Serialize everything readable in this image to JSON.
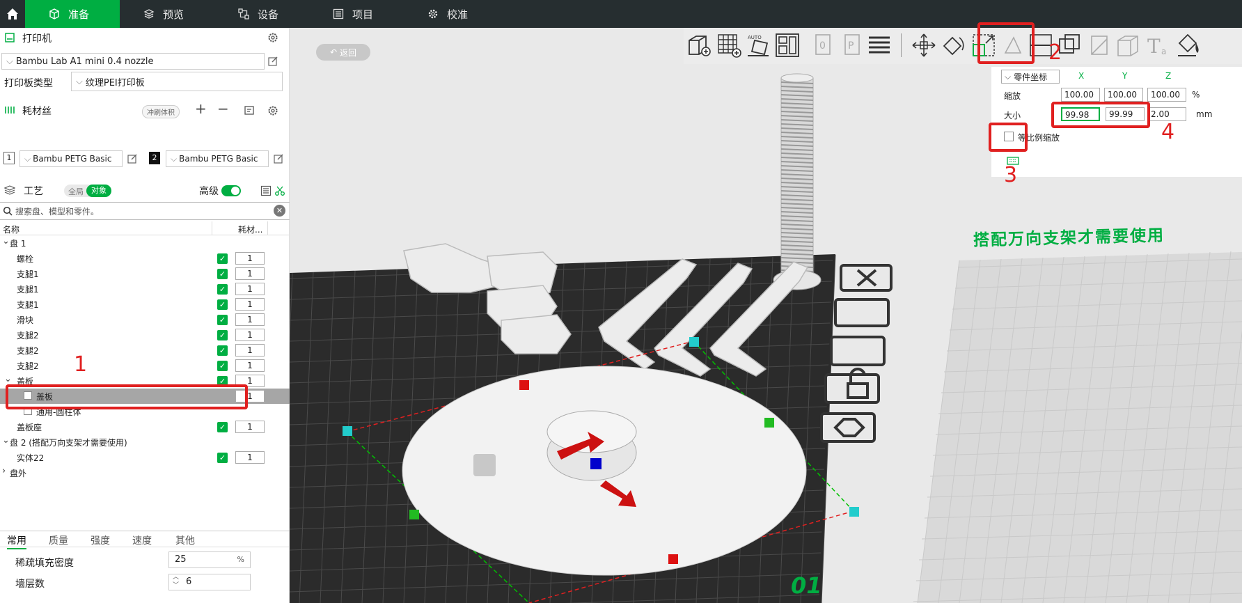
{
  "topbar": {
    "tabs": [
      {
        "label": "准备"
      },
      {
        "label": "预览"
      },
      {
        "label": "设备"
      },
      {
        "label": "项目"
      },
      {
        "label": "校准"
      }
    ]
  },
  "printer": {
    "title": "打印机",
    "name": "Bambu Lab A1 mini 0.4 nozzle",
    "plate_type_label": "打印板类型",
    "plate_type_value": "纹理PEI打印板"
  },
  "filament": {
    "title": "耗材丝",
    "flush_label": "冲刷体积",
    "slots": [
      {
        "index": "1",
        "name": "Bambu PETG Basic"
      },
      {
        "index": "2",
        "name": "Bambu PETG Basic"
      }
    ]
  },
  "process": {
    "title": "工艺",
    "toggle_global": "全局",
    "toggle_object": "对象",
    "advanced_label": "高级",
    "search_placeholder": "搜索盘、模型和零件。"
  },
  "object_tree": {
    "col_name": "名称",
    "col_filament": "耗材...",
    "rows": [
      {
        "name": "盘 1",
        "level": 0,
        "expand": "v"
      },
      {
        "name": "螺栓",
        "level": 1,
        "checked": true,
        "value": "1"
      },
      {
        "name": "支腿1",
        "level": 1,
        "checked": true,
        "value": "1"
      },
      {
        "name": "支腿1",
        "level": 1,
        "checked": true,
        "value": "1"
      },
      {
        "name": "支腿1",
        "level": 1,
        "checked": true,
        "value": "1"
      },
      {
        "name": "滑块",
        "level": 1,
        "checked": true,
        "value": "1"
      },
      {
        "name": "支腿2",
        "level": 1,
        "checked": true,
        "value": "1"
      },
      {
        "name": "支腿2",
        "level": 1,
        "checked": true,
        "value": "1"
      },
      {
        "name": "支腿2",
        "level": 1,
        "checked": true,
        "value": "1"
      },
      {
        "name": "盖板",
        "level": 1,
        "checked": true,
        "value": "1",
        "expand": "v"
      },
      {
        "name": "盖板",
        "level": 2,
        "selected": true,
        "value": "1"
      },
      {
        "name": "通用-圆柱体",
        "level": 2
      },
      {
        "name": "盖板座",
        "level": 1,
        "checked": true,
        "value": "1"
      },
      {
        "name": "盘 2 (搭配万向支架才需要使用)",
        "level": 0,
        "expand": "v"
      },
      {
        "name": "实体22",
        "level": 1,
        "checked": true,
        "value": "1"
      },
      {
        "name": "盘外",
        "level": 0,
        "expand": ">"
      }
    ]
  },
  "param_tabs": [
    {
      "label": "常用"
    },
    {
      "label": "质量"
    },
    {
      "label": "强度"
    },
    {
      "label": "速度"
    },
    {
      "label": "其他"
    }
  ],
  "params": {
    "infill_label": "稀疏填充密度",
    "infill_value": "25",
    "infill_unit": "%",
    "walls_label": "墙层数",
    "walls_value": "6"
  },
  "view": {
    "back_label": "返回",
    "plate_text": "搭配万向支架才需要使用",
    "plate_number": "01"
  },
  "scale_panel": {
    "coord_label": "零件坐标",
    "axis_x": "X",
    "axis_y": "Y",
    "axis_z": "Z",
    "scale_label": "缩放",
    "scale_x": "100.00",
    "scale_y": "100.00",
    "scale_z": "100.00",
    "scale_unit": "%",
    "size_label": "大小",
    "size_x": "99.98",
    "size_y": "99.99",
    "size_z": "2.00",
    "size_unit": "mm",
    "uniform_label": "等比例缩放"
  },
  "annotations": {
    "n1": "1",
    "n2": "2",
    "n3": "3",
    "n4": "4"
  },
  "colors": {
    "accent": "#00ae42",
    "annotation": "#e02020",
    "topbar": "#262e30",
    "plate": "#2b2b2b"
  }
}
